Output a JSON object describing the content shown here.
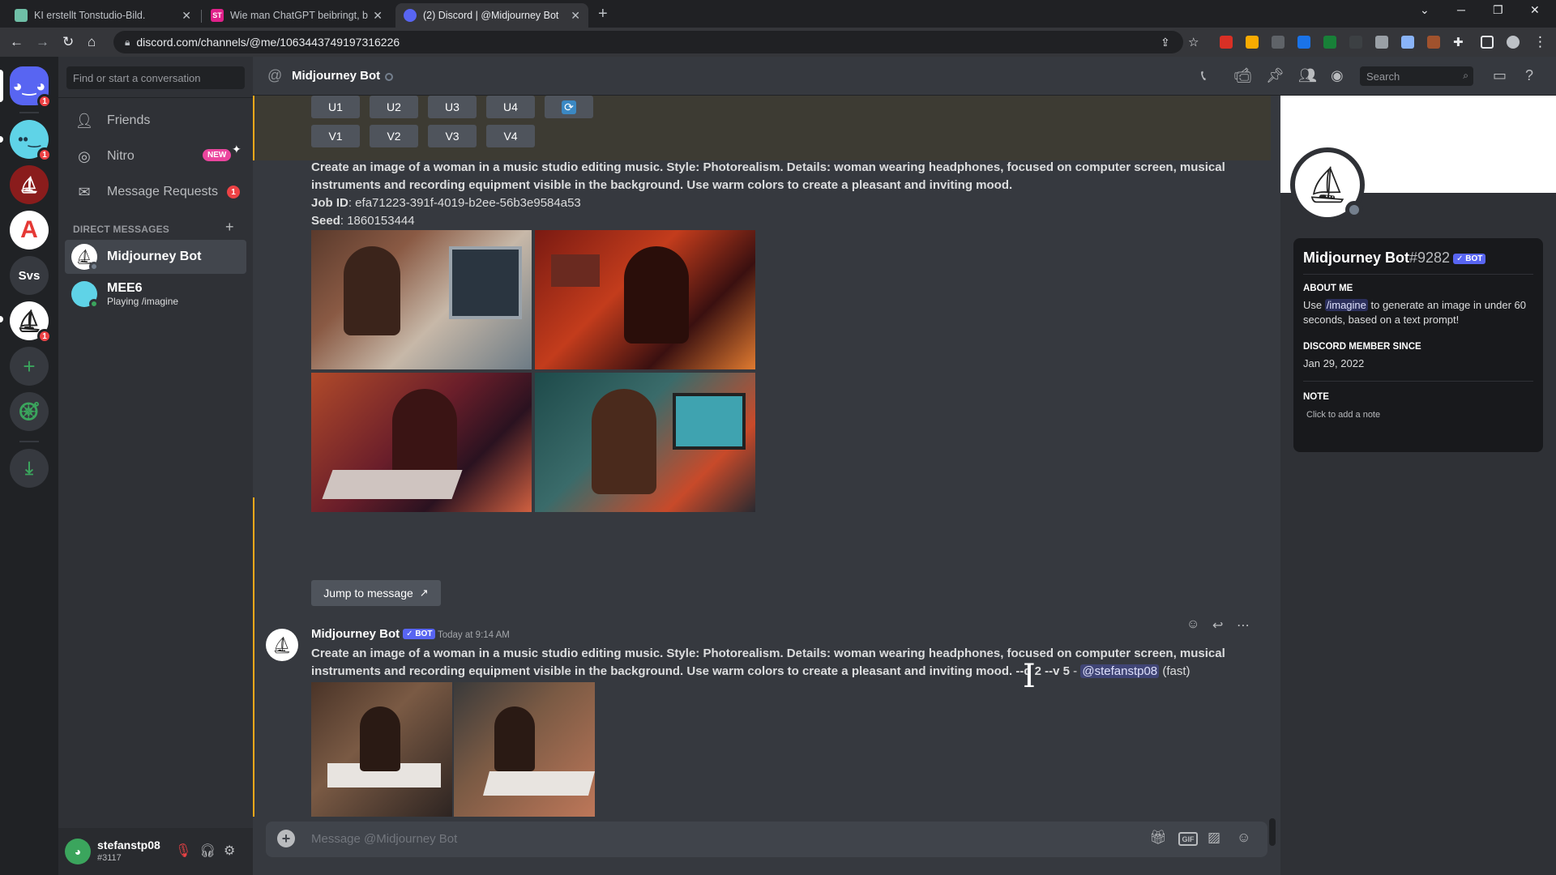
{
  "browser": {
    "tabs": [
      {
        "title": "KI erstellt Tonstudio-Bild.",
        "icon_color": "#6fbfa7"
      },
      {
        "title": "Wie man ChatGPT beibringt, bes",
        "icon_color": "#e0218a"
      },
      {
        "title": "(2) Discord | @Midjourney Bot",
        "icon_color": "#5865f2"
      }
    ],
    "url": "discord.com/channels/@me/1063443749197316226"
  },
  "discord": {
    "dm_search_placeholder": "Find or start a conversation",
    "nav": {
      "friends": "Friends",
      "nitro": "Nitro",
      "nitro_badge": "NEW",
      "message_requests": "Message Requests",
      "message_requests_count": "1"
    },
    "servers": {
      "server_text": "Svs",
      "badges": [
        "1",
        "1",
        "1"
      ]
    },
    "dm_header": "DIRECT MESSAGES",
    "dms": [
      {
        "name": "Midjourney Bot",
        "sub": ""
      },
      {
        "name": "MEE6",
        "sub": "Playing /imagine"
      }
    ],
    "user": {
      "name": "stefanstp08",
      "tag": "#3117"
    },
    "channel_title": "Midjourney Bot",
    "header_search_placeholder": "Search",
    "buttons": {
      "u": [
        "U1",
        "U2",
        "U3",
        "U4"
      ],
      "v": [
        "V1",
        "V2",
        "V3",
        "V4"
      ]
    },
    "first_message": {
      "prompt": "Create an image of a woman in a music studio editing music. Style: Photorealism. Details: woman wearing headphones, focused on computer screen, musical instruments and recording equipment visible in the background. Use warm colors to create a pleasant and inviting mood.",
      "job_id_label": "Job ID",
      "job_id": ": efa71223-391f-4019-b2ee-56b3e9584a53",
      "seed_label": "Seed",
      "seed": ": 1860153444",
      "jump_label": "Jump to message"
    },
    "second_message": {
      "author": "Midjourney Bot",
      "bot_label": "✓ BOT",
      "time": "Today at 9:14 AM",
      "prompt": "Create an image of a woman in a music studio editing music. Style: Photorealism. Details: woman wearing headphones, focused on computer screen, musical instruments and recording equipment visible in the background. Use warm colors to create a pleasant and inviting mood. --q 2 --v 5",
      "dash": " - ",
      "mention": "@stefanstp08",
      "mode": " (fast)"
    },
    "composer_placeholder": "Message @Midjourney Bot",
    "gif_label": "GIF",
    "profile": {
      "name": "Midjourney Bot",
      "discriminator": "#9282",
      "bot_label": "✓ BOT",
      "about_me_header": "ABOUT ME",
      "about_pre": "Use ",
      "about_cmd": "/imagine",
      "about_post": " to generate an image in under 60 seconds, based on a text prompt!",
      "member_since_header": "DISCORD MEMBER SINCE",
      "member_since": "Jan 29, 2022",
      "note_header": "NOTE",
      "note_placeholder": "Click to add a note"
    },
    "colors": {
      "blurple": "#5865f2",
      "mention_bar": "#faa81a",
      "bg": "#36393f"
    }
  }
}
